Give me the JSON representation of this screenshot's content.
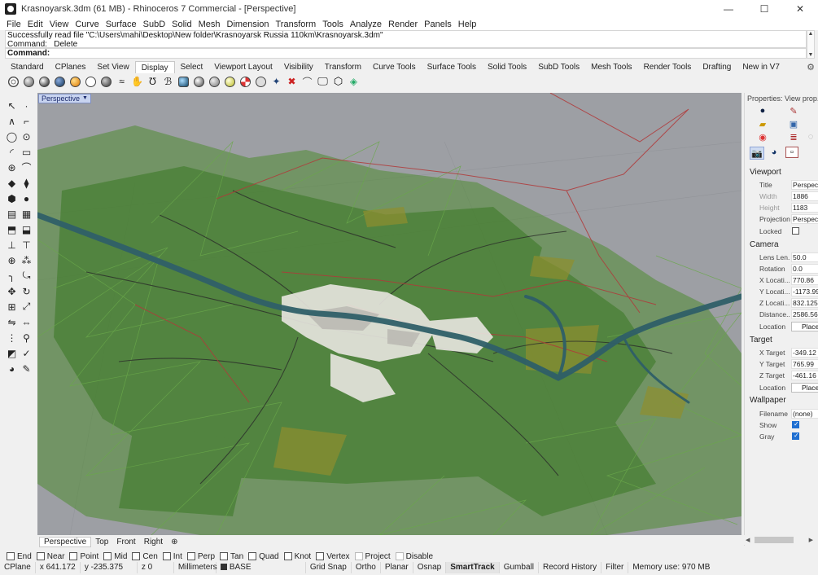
{
  "window": {
    "title": "Krasnoyarsk.3dm (61 MB) - Rhinoceros 7 Commercial - [Perspective]",
    "minimize": "—",
    "maximize": "☐",
    "close": "✕"
  },
  "menu": [
    "File",
    "Edit",
    "View",
    "Curve",
    "Surface",
    "SubD",
    "Solid",
    "Mesh",
    "Dimension",
    "Transform",
    "Tools",
    "Analyze",
    "Render",
    "Panels",
    "Help"
  ],
  "command": {
    "history_line1": "Successfully read file \"C:\\Users\\mahi\\Desktop\\New folder\\Krasnoyarsk Russia 110km\\Krasnoyarsk.3dm\"",
    "history_line2": "Command: _Delete",
    "prompt": "Command:"
  },
  "toolbar_tabs": [
    "Standard",
    "CPlanes",
    "Set View",
    "Display",
    "Select",
    "Viewport Layout",
    "Visibility",
    "Transform",
    "Curve Tools",
    "Surface Tools",
    "Solid Tools",
    "SubD Tools",
    "Mesh Tools",
    "Render Tools",
    "Drafting",
    "New in V7"
  ],
  "toolbar_active_tab": "Display",
  "viewport": {
    "title": "Perspective",
    "tabs": [
      "Perspective",
      "Top",
      "Front",
      "Right"
    ],
    "add_tab_icon": "⊕"
  },
  "osnaps": [
    {
      "label": "End",
      "checked": false
    },
    {
      "label": "Near",
      "checked": false
    },
    {
      "label": "Point",
      "checked": false
    },
    {
      "label": "Mid",
      "checked": false
    },
    {
      "label": "Cen",
      "checked": false
    },
    {
      "label": "Int",
      "checked": false
    },
    {
      "label": "Perp",
      "checked": false
    },
    {
      "label": "Tan",
      "checked": false
    },
    {
      "label": "Quad",
      "checked": false
    },
    {
      "label": "Knot",
      "checked": false
    },
    {
      "label": "Vertex",
      "checked": false
    },
    {
      "label": "Project",
      "checked": false
    },
    {
      "label": "Disable",
      "checked": false
    }
  ],
  "status": {
    "cplane": "CPlane",
    "x": "x 641.172",
    "y": "y -235.375",
    "z": "z 0",
    "units": "Millimeters",
    "layer": "BASE",
    "grid_snap": "Grid Snap",
    "ortho": "Ortho",
    "planar": "Planar",
    "osnap": "Osnap",
    "smarttrack": "SmartTrack",
    "gumball": "Gumball",
    "record_history": "Record History",
    "filter": "Filter",
    "memory": "Memory use: 970 MB"
  },
  "properties": {
    "title": "Properties: View prop...",
    "viewport_section": "Viewport",
    "title_label": "Title",
    "title_value": "Perspective",
    "width_label": "Width",
    "width_value": "1886",
    "height_label": "Height",
    "height_value": "1183",
    "projection_label": "Projection",
    "projection_value": "Perspective",
    "locked_label": "Locked",
    "camera_section": "Camera",
    "lens_label": "Lens Len...",
    "lens_value": "50.0",
    "rotation_label": "Rotation",
    "rotation_value": "0.0",
    "xloc_label": "X Locati...",
    "xloc_value": "770.86",
    "yloc_label": "Y Locati...",
    "yloc_value": "-1173.99",
    "zloc_label": "Z Locati...",
    "zloc_value": "832.125",
    "distance_label": "Distance...",
    "distance_value": "2586.56",
    "location_label": "Location",
    "place_button": "Place...",
    "target_section": "Target",
    "xtarget_label": "X Target",
    "xtarget_value": "-349.12",
    "ytarget_label": "Y Target",
    "ytarget_value": "765.99",
    "ztarget_label": "Z Target",
    "ztarget_value": "-461.16",
    "tlocation_label": "Location",
    "tplace_button": "Place...",
    "wallpaper_section": "Wallpaper",
    "filename_label": "Filename",
    "filename_value": "(none)",
    "show_label": "Show",
    "gray_label": "Gray"
  },
  "colors": {
    "viewport_bg": "#9d9fa4",
    "terrain_green": "#4e8a32",
    "river": "#2f5f68",
    "boundary_red": "#b0393a",
    "city_white": "#e8e6e0",
    "accent_blue": "#1f6fd1"
  }
}
